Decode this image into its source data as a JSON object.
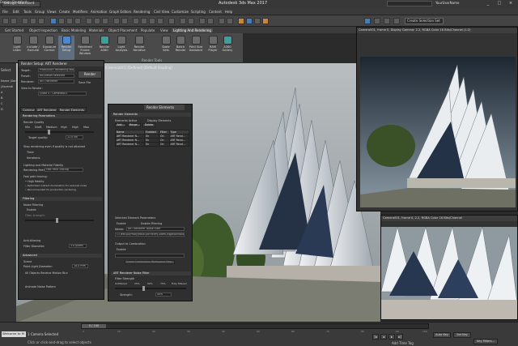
{
  "window": {
    "title": "Autodesk 3ds Max 2017",
    "workspace": "Design Standard",
    "search_placeholder": "Type a keyword or phrase",
    "user": "YourUserName",
    "controls": [
      "_",
      "□",
      "×"
    ]
  },
  "menu": [
    "File",
    "Edit",
    "Tools",
    "Group",
    "Views",
    "Create",
    "Modifiers",
    "Animation",
    "Graph Editors",
    "Rendering",
    "Civil View",
    "Customize",
    "Scripting",
    "Content",
    "Help"
  ],
  "main_toolbar": {
    "named_selection": "Create Selection Set"
  },
  "ribbon": {
    "tabs": [
      "Get Started",
      "Object Inspection",
      "Basic Modeling",
      "Materials",
      "Object Placement",
      "Populate",
      "View",
      "Lighting And Rendering"
    ],
    "active_tab": "Lighting And Rendering",
    "buttons": [
      "Light Lister",
      "Include / Exclude",
      "Exposure Control",
      "Render Setup",
      "Rendered Frame Window",
      "Render A360",
      "Light Analysis",
      "Render Iterative",
      "State Sets",
      "Batch Render",
      "Print Size Assistant",
      "RAM Player",
      "A360 Gallery"
    ],
    "group_label": "Render Tools",
    "left_label": "Lights"
  },
  "scene_explorer": {
    "header": "Select",
    "items": [
      "Name (Sorted Ascending)",
      "(Ascendi",
      "A",
      "B",
      "C",
      "D"
    ]
  },
  "viewport": {
    "label": "[+] [Camera001] [Defined] [Default Shading]"
  },
  "render_setup": {
    "title": "Render Setup: ART Renderer",
    "target_label": "Target:",
    "target_value": "Production Rendering Mode",
    "preset_label": "Preset:",
    "preset_value": "No preset selected",
    "renderer_label": "Renderer:",
    "renderer_value": "ART Renderer",
    "save_file": "Save File",
    "view_label": "View to Render:",
    "view_value": "Quad 4 - Camera001",
    "render_button": "Render",
    "tabs": [
      "Common",
      "ART Renderer",
      "Render Elements"
    ],
    "rendering_params": "Rendering Parameters",
    "render_quality": "Render Quality",
    "quality_levels": [
      "Min",
      "Draft",
      "Medium",
      "High",
      "High",
      "Max"
    ],
    "target_quality_label": "Target quality:",
    "target_quality_value": "12.0 dB",
    "stop_label": "Stop rendering even if quality is not attained",
    "time_label": "Time:",
    "iterations_label": "Iterations:",
    "lighting_fidelity": "Lighting and Material Fidelity",
    "rendering_method_label": "Rendering Method:",
    "rendering_method_value": "Fast Path Tracing",
    "fast_path_tracing": "Fast path tracing:",
    "ftc_notes": [
      "• High fidelity",
      "• Optimized indirect illumination for reduced noise",
      "• Recommended for production rendering"
    ],
    "filtering": "Filtering",
    "noise_filtering": "Noise Filtering",
    "enable": "Enable",
    "filter_strength": "Filter strength:",
    "anti_aliasing": "Anti-Aliasing",
    "filter_diameter_label": "Filter Diameter:",
    "filter_diameter_value": "3.0 pixels",
    "advanced": "Advanced",
    "scene": "Scene",
    "point_light_label": "Point Light Diameter:",
    "point_light_value": "10.0 mm",
    "motion_blur": "All Objects Receive Motion Blur",
    "noise_pattern": "Animate Noise Pattern"
  },
  "render_elements": {
    "tab": "Render Elements",
    "section": "Render Elements",
    "elements_active": "Elements Active",
    "display_elements": "Display Elements",
    "buttons": [
      "Add...",
      "Merge...",
      "Delete"
    ],
    "columns": [
      "Name",
      "Enabled",
      "Filter",
      "Type"
    ],
    "rows": [
      [
        "ART Renderer N...",
        "On",
        "On",
        "ART Rend..."
      ],
      [
        "ART Renderer N...",
        "On",
        "On",
        "ART Rend..."
      ],
      [
        "ART Renderer N...",
        "On",
        "On",
        "ART Rend..."
      ]
    ],
    "selected_params": "Selected Element Parameters",
    "enable": "Enable",
    "enable_filtering": "Enable Filtering",
    "name_label": "Name:",
    "name_value": "ART Renderer Noise Filter",
    "path_value": "C:\\Test\\Go\\Proxy\\RBSE\\AirForce\\CadetChapelAntNois...",
    "output_combustion": "Output to Combustion",
    "enable2": "Enable",
    "create_ws": "Create Combustion Workspace Now...",
    "noise_filter": "ART Renderer Noise Filter",
    "filter_strength": "Filter Strength",
    "strength_marks": [
      "Unfiltered",
      "25%",
      "50%",
      "75%",
      "Fully filtered"
    ],
    "strength_label": "Strength:",
    "strength_value": "40%"
  },
  "render_window1": {
    "title": "Camera001, frame 0, Display Gamma: 2.2, RGBA Color 16 Bits/Channel (1:2)"
  },
  "render_window2": {
    "title": "Camera001, frame 0, 2.2, RGBA Color 16 Bits/Channel"
  },
  "status": {
    "workspace": "Design Standard",
    "welcome": "Welcome to M",
    "message1": "1 Camera Selected",
    "message2": "Click or click-and-drag to select objects",
    "add_time_tag": "Add Time Tag",
    "auto_key": "Auto Key",
    "set_key": "Set Key",
    "key_filters": "Key Filters...",
    "frames": "0 / 100",
    "ticks": [
      "0",
      "10",
      "20",
      "30",
      "40",
      "50",
      "60",
      "70",
      "80",
      "90",
      "100"
    ]
  },
  "colors": {
    "accent": "#3e7fc4",
    "ui_bg": "#2b2b2b",
    "status_blue": "#1e3a8a"
  }
}
